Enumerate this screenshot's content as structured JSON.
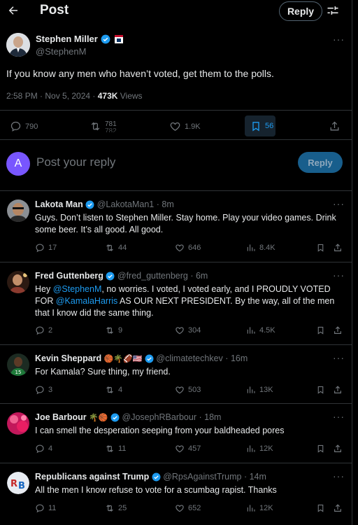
{
  "header": {
    "title": "Post",
    "reply_label": "Reply"
  },
  "post": {
    "name": "Stephen Miller",
    "handle": "@StephenM",
    "text": "If you know any men who haven’t voted, get them to the polls.",
    "time": "2:58 PM · Nov 5, 2024 · ",
    "views": "473K",
    "views_label": " Views",
    "replies": "790",
    "reposts_top": "781",
    "reposts_bottom": "782",
    "likes": "1.9K",
    "bookmarks": "56",
    "bookmark_color": "#1d9bf0"
  },
  "reply_box": {
    "avatar_letter": "A",
    "placeholder": "Post your reply",
    "button_label": "Reply"
  },
  "replies": [
    {
      "name": "Lakota Man",
      "handle": "@LakotaMan1",
      "time": "8m",
      "text": "Guys. Don’t listen to Stephen Miller. Stay home. Play your video games. Drink some beer. It’s all good. All good.",
      "replies": "17",
      "reposts": "44",
      "likes": "646",
      "views": "8.4K"
    },
    {
      "name": "Fred Guttenberg",
      "handle": "@fred_guttenberg",
      "time": "6m",
      "text_pre": "Hey ",
      "mention1": "@StephenM",
      "text_mid": ", no worries.  I voted, I voted early, and I PROUDLY VOTED FOR ",
      "mention2": "@KamalaHarris",
      "text_post": " AS OUR NEXT PRESIDENT.   By the way, all of the men that I know did the same thing.",
      "replies": "2",
      "reposts": "9",
      "likes": "304",
      "views": "4.5K"
    },
    {
      "name": "Kevin Sheppard",
      "emoji": "🏀🌴🏈🇺🇸",
      "handle": "@climatetechkev",
      "time": "16m",
      "text": "For Kamala? Sure thing, my friend.",
      "replies": "3",
      "reposts": "4",
      "likes": "503",
      "views": "13K"
    },
    {
      "name": "Joe Barbour",
      "emoji": "🌴🏀",
      "handle": "@JosephRBarbour",
      "time": "18m",
      "text": "I can smell the desperation seeping from your baldheaded pores",
      "replies": "4",
      "reposts": "11",
      "likes": "457",
      "views": "12K"
    },
    {
      "name": "Republicans against Trump",
      "handle": "@RpsAgainstTrump",
      "time": "14m",
      "text": "All the men I know refuse to vote for a scumbag rapist. Thanks",
      "replies": "11",
      "reposts": "25",
      "likes": "652",
      "views": "12K"
    }
  ],
  "colors": {
    "background": "#000000",
    "text": "#e7e9ea",
    "muted": "#71767b",
    "accent": "#1d9bf0",
    "verified": "#1d9bf0"
  },
  "icons": [
    "back-arrow-icon",
    "tune-icon",
    "verified-badge-icon",
    "flag-badge-icon",
    "more-icon",
    "reply-icon",
    "repost-icon",
    "like-icon",
    "views-icon",
    "bookmark-icon",
    "share-icon"
  ]
}
